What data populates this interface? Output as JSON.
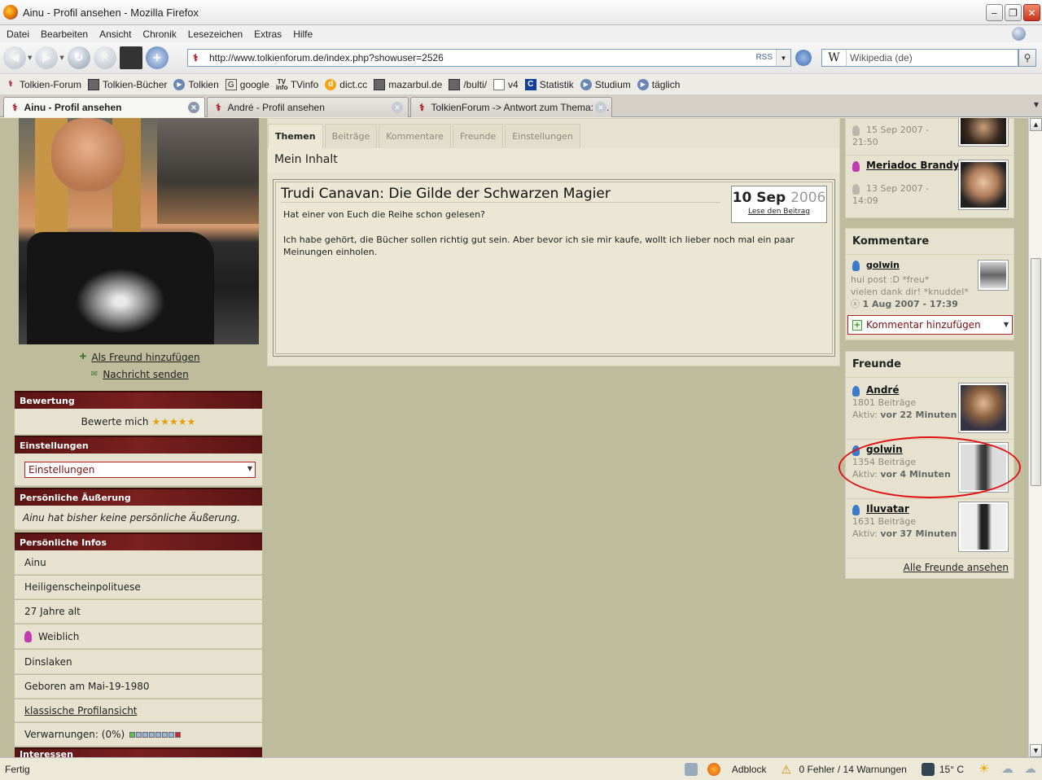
{
  "window": {
    "title": "Ainu - Profil ansehen - Mozilla Firefox"
  },
  "menu": [
    "Datei",
    "Bearbeiten",
    "Ansicht",
    "Chronik",
    "Lesezeichen",
    "Extras",
    "Hilfe"
  ],
  "nav": {
    "url": "http://www.tolkienforum.de/index.php?showuser=2526",
    "rss": "RSS",
    "search_placeholder": "Wikipedia (de)",
    "search_engine": "W"
  },
  "bookmarks": [
    "Tolkien-Forum",
    "Tolkien-Bücher",
    "Tolkien",
    "google",
    "TVinfo",
    "dict.cc",
    "mazarbul.de",
    "/bulti/",
    "v4",
    "Statistik",
    "Studium",
    "täglich"
  ],
  "tabs": [
    "Ainu - Profil ansehen",
    "André - Profil ansehen",
    "TolkienForum -> Antwort zum Thema: F..."
  ],
  "profile": {
    "add_friend": "Als Freund hinzufügen",
    "send_message": "Nachricht senden",
    "rating_head": "Bewertung",
    "rating_text": "Bewerte mich",
    "stars": "★★★★★",
    "settings_head": "Einstellungen",
    "settings_select": "Einstellungen",
    "statement_head": "Persönliche Äußerung",
    "statement_text": "Ainu hat bisher keine persönliche Äußerung.",
    "info_head": "Persönliche Infos",
    "info": {
      "name": "Ainu",
      "title": "Heiligenscheinpolituese",
      "age": "27 Jahre alt",
      "gender": "Weiblich",
      "location": "Dinslaken",
      "birthday": "Geboren am Mai-19-1980",
      "classic_link": "klassische Profilansicht",
      "warnings": "Verwarnungen: (0%)"
    },
    "interests_head": "Interessen"
  },
  "main": {
    "tabs": [
      "Themen",
      "Beiträge",
      "Kommentare",
      "Freunde",
      "Einstellungen"
    ],
    "heading": "Mein Inhalt",
    "post": {
      "title": "Trudi Canavan: Die Gilde der Schwarzen Magier",
      "date_day": "10 Sep",
      "date_year": "2006",
      "read_link": "Lese den Beitrag",
      "line1": "Hat einer von Euch die Reihe schon gelesen?",
      "line2": "Ich habe gehört, die Bücher sollen richtig gut sein. Aber bevor ich sie mir kaufe, wollt ich lieber noch mal ein paar Meinungen einholen."
    }
  },
  "right": {
    "visitors": [
      {
        "date": "15 Sep 2007 -",
        "time": "21:50"
      },
      {
        "name": "Meriadoc Brandyb...",
        "date": "13 Sep 2007 -",
        "time": "14:09"
      }
    ],
    "comments_head": "Kommentare",
    "comment": {
      "user": "golwin",
      "line1": "hui post :D *freu*",
      "line2": "vielen dank dir! *knuddel*",
      "date": "1 Aug 2007 - 17:39"
    },
    "add_comment": "Kommentar hinzufügen",
    "friends_head": "Freunde",
    "friends": [
      {
        "name": "André",
        "posts": "1801 Beiträge",
        "active_label": "Aktiv:",
        "active": "vor 22 Minuten"
      },
      {
        "name": "golwin",
        "posts": "1354 Beiträge",
        "active_label": "Aktiv:",
        "active": "vor 4 Minuten"
      },
      {
        "name": "Iluvatar",
        "posts": "1631 Beiträge",
        "active_label": "Aktiv:",
        "active": "vor 37 Minuten"
      }
    ],
    "all_friends": "Alle Freunde ansehen"
  },
  "status": {
    "left": "Fertig",
    "adblock": "Adblock",
    "errors": "0 Fehler / 14 Warnungen",
    "temp": "15° C"
  },
  "colors": {
    "section_header": "#6a1a1a",
    "page_bg": "#bfbc9e",
    "panel_bg": "#e6e2cf",
    "highlight_circle": "#e21010"
  }
}
